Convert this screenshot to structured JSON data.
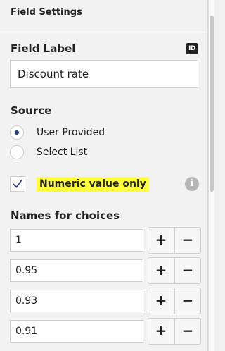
{
  "panel": {
    "title": "Field Settings"
  },
  "field_label": {
    "heading": "Field Label",
    "id_icon_text": "ID",
    "value": "Discount rate"
  },
  "source": {
    "heading": "Source",
    "options": [
      {
        "label": "User Provided",
        "selected": true
      },
      {
        "label": "Select List",
        "selected": false
      }
    ]
  },
  "numeric": {
    "label": "Numeric value only",
    "checked": true,
    "highlight_color": "#ffff3a",
    "info_icon_text": "i"
  },
  "choices": {
    "heading": "Names for choices",
    "plus_label": "+",
    "minus_label": "−",
    "items": [
      "1",
      "0.95",
      "0.93",
      "0.91"
    ]
  },
  "colors": {
    "radio_selected": "#1e3a8a",
    "checkmark": "#2a3a8c"
  }
}
